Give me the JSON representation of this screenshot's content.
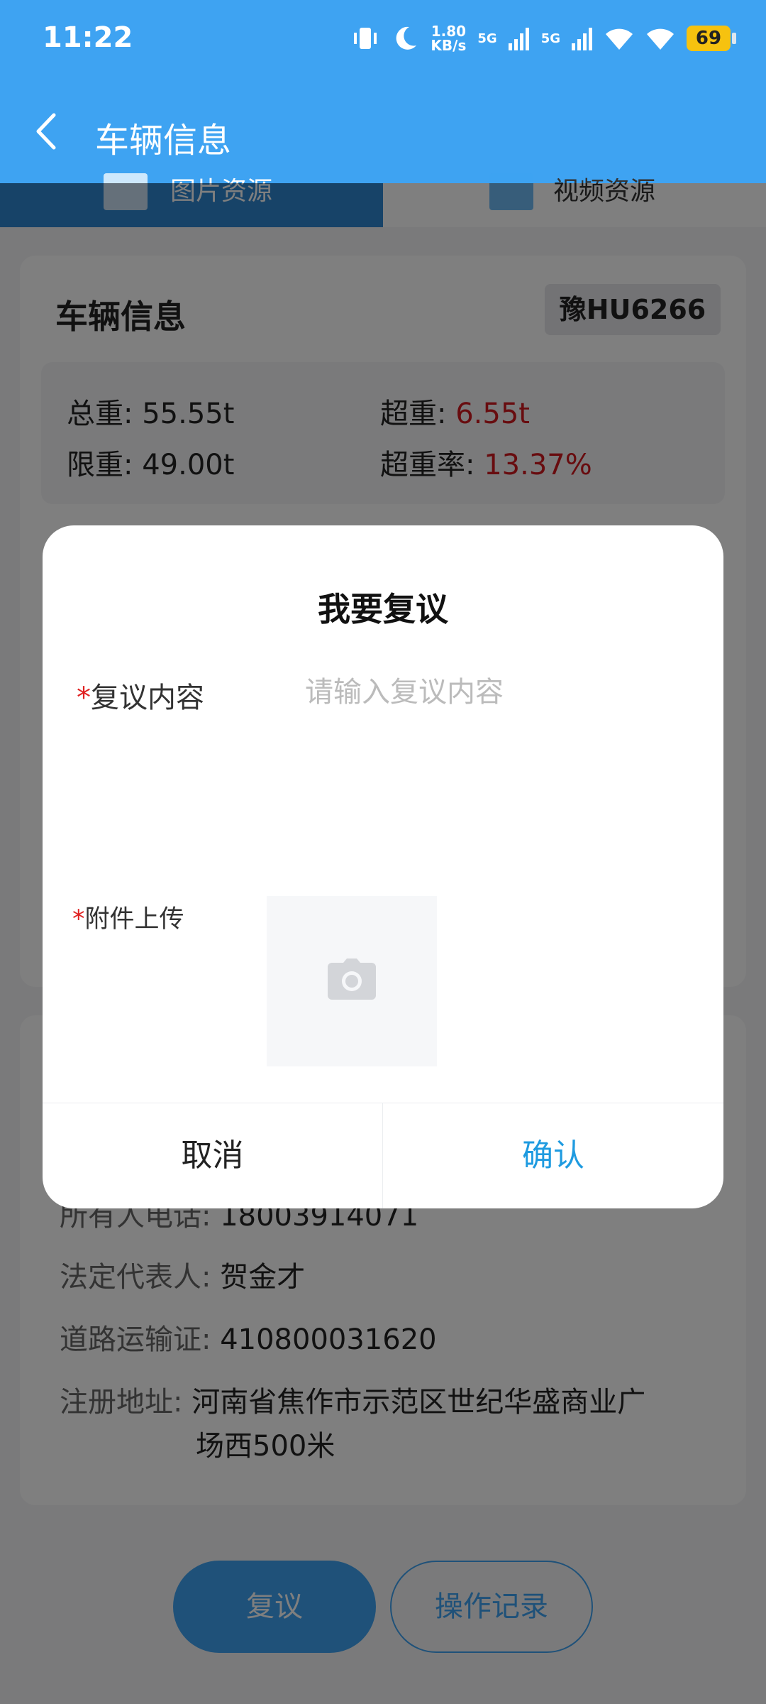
{
  "status_bar": {
    "time": "11:22",
    "net_speed_value": "1.80",
    "net_speed_unit": "KB/s",
    "sig1": "5G",
    "sig2": "5G",
    "battery": "69"
  },
  "header": {
    "title": "车辆信息"
  },
  "tabs": [
    {
      "label": "图片资源"
    },
    {
      "label": "视频资源"
    }
  ],
  "vehicle": {
    "title": "车辆信息",
    "plate": "豫HU6266",
    "gross_label": "总重: ",
    "gross_value": "55.55t",
    "over_label": "超重: ",
    "over_value": "6.55t",
    "limit_label": "限重: ",
    "limit_value": "49.00t",
    "rate_label": "超重率: ",
    "rate_value": "13.37%"
  },
  "owner": {
    "phone_label": "所有人电话: ",
    "phone_value": "18003914071",
    "legal_label": "法定代表人: ",
    "legal_value": "贺金才",
    "permit_label": "道路运输证: ",
    "permit_value": "410800031620",
    "address_label": "注册地址: ",
    "address_line1": "河南省焦作市示范区世纪华盛商业广",
    "address_line2": "场西500米"
  },
  "actions": {
    "review": "复议",
    "log": "操作记录"
  },
  "dialog": {
    "title": "我要复议",
    "required_mark": "*",
    "content_label": "复议内容",
    "content_placeholder": "请输入复议内容",
    "attach_label": "附件上传",
    "cancel": "取消",
    "confirm": "确认"
  },
  "colors": {
    "primary": "#3ea3f2",
    "danger": "#d0191f",
    "confirm": "#1f9be0"
  }
}
